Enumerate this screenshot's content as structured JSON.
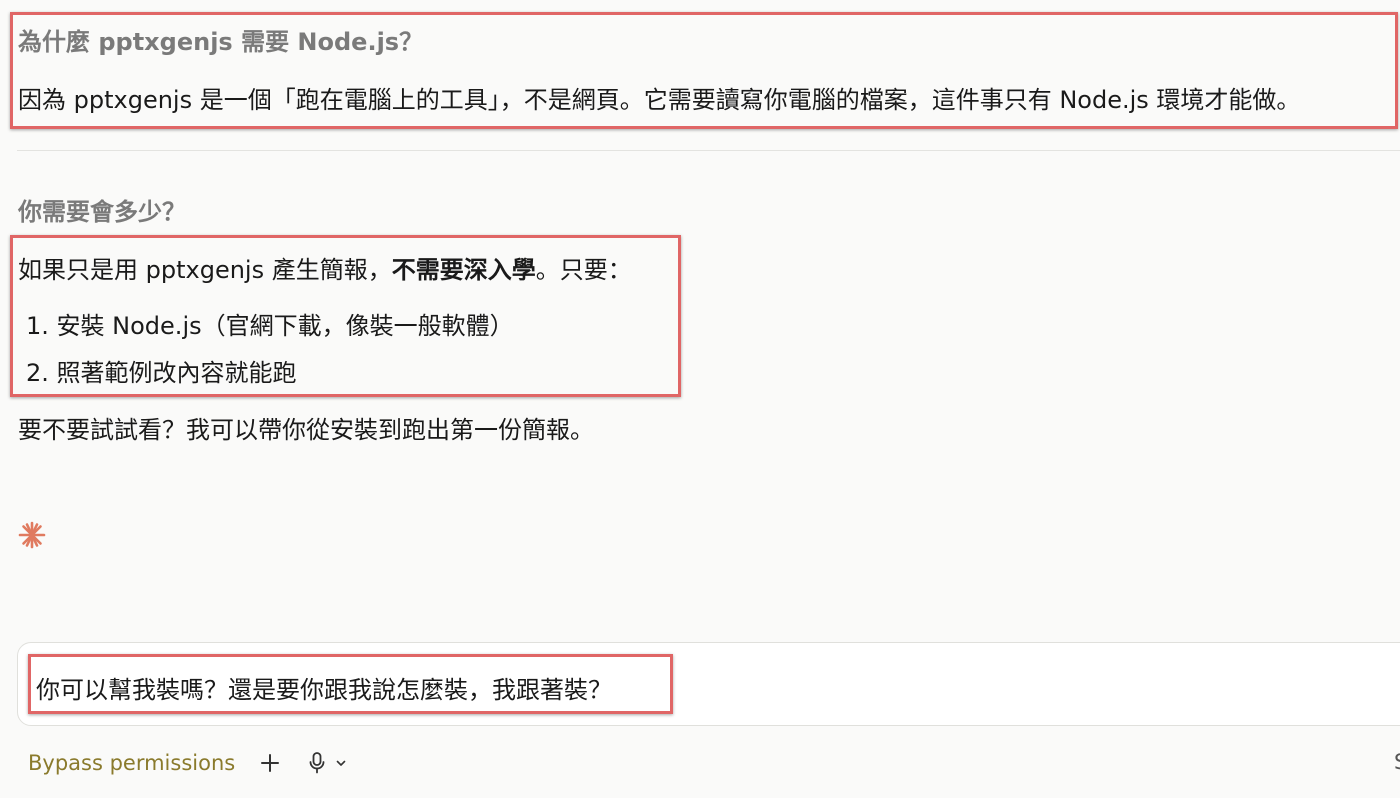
{
  "section1": {
    "heading": "為什麼 pptxgenjs 需要 Node.js？",
    "text": "因為 pptxgenjs 是一個「跑在電腦上的工具」，不是網頁。它需要讀寫你電腦的檔案，這件事只有 Node.js 環境才能做。"
  },
  "section2": {
    "heading": "你需要會多少？",
    "intro_pre": "如果只是用 pptxgenjs 產生簡報，",
    "intro_bold": "不需要深入學",
    "intro_post": "。只要：",
    "steps": [
      {
        "num": "1.",
        "text": "安裝 Node.js（官網下載，像裝一般軟體）"
      },
      {
        "num": "2.",
        "text": "照著範例改內容就能跑"
      }
    ],
    "followup": "要不要試試看？我可以帶你從安裝到跑出第一份簡報。"
  },
  "icons": {
    "status": "sparkle-icon",
    "add": "plus-icon",
    "voice": "microphone-icon",
    "expand": "chevron-down-icon"
  },
  "composer": {
    "value": "你可以幫我裝嗎？還是要你跟我說怎麼裝，我跟著裝？"
  },
  "toolbar": {
    "mode_label": "Bypass permissions",
    "edge_glyph": "S"
  },
  "colors": {
    "annotation": "#e06666",
    "accent": "#e07a5f",
    "mode": "#8a7a2c"
  }
}
